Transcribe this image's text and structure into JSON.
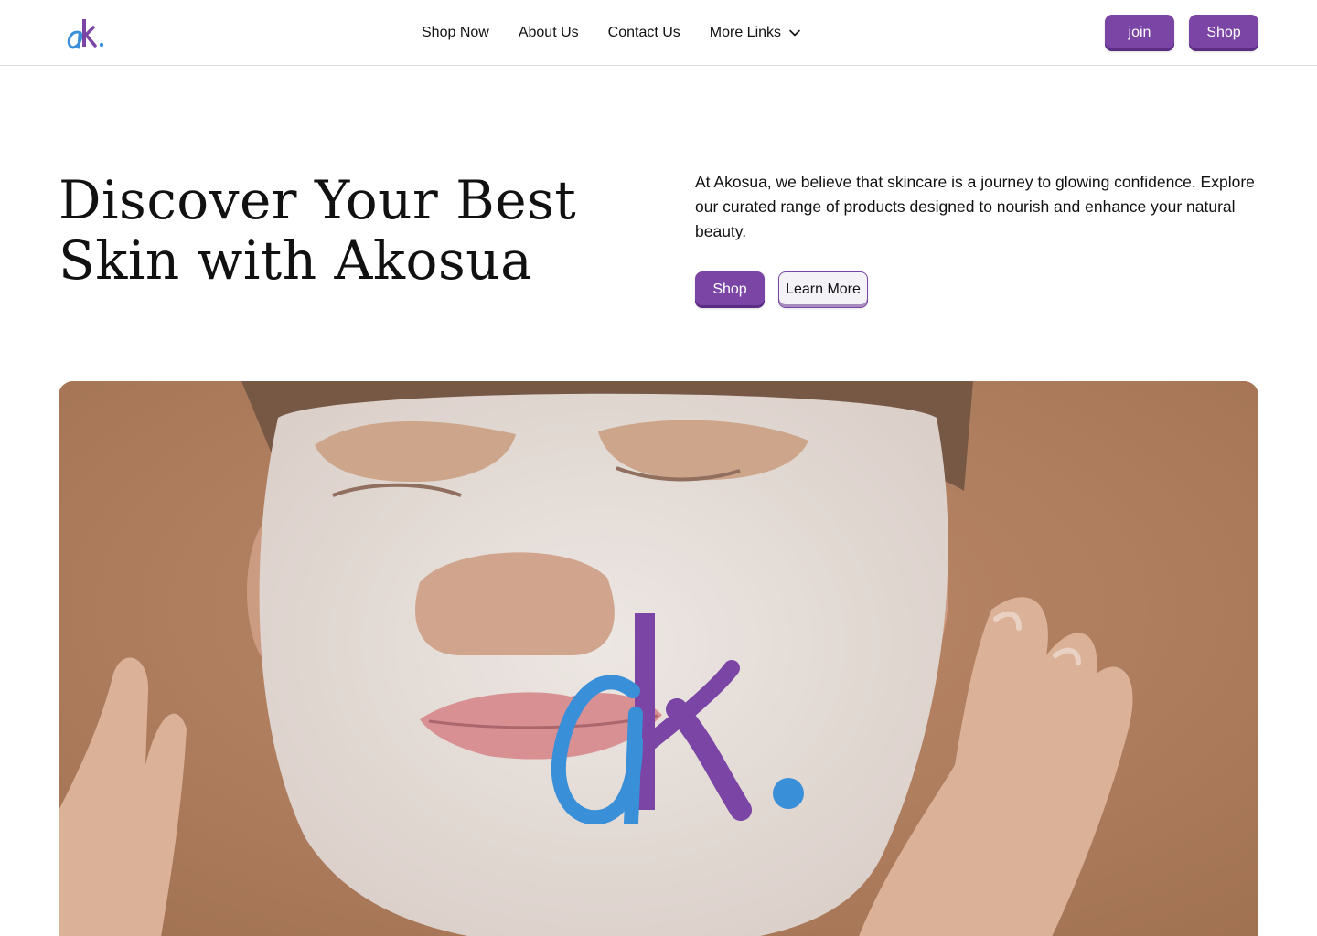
{
  "brand": {
    "logo_text": "ak.",
    "colors": {
      "blue": "#3a8fd9",
      "purple": "#7a45a4"
    }
  },
  "nav": {
    "links": [
      "Shop Now",
      "About Us",
      "Contact Us"
    ],
    "more_label": "More Links",
    "more_icon": "chevron-down-icon"
  },
  "header_buttons": {
    "join_label": "join",
    "shop_label": "Shop"
  },
  "hero": {
    "title_line1": "Discover Your Best",
    "title_line2": "Skin with Akosua",
    "description": "At Akosua, we believe that skincare is a journey to glowing confidence. Explore our curated range of products designed to nourish and enhance your natural beauty.",
    "shop_label": "Shop",
    "learn_more_label": "Learn More"
  },
  "theme": {
    "primary": "#7a45a4",
    "background": "#ffffff",
    "text": "#111111"
  }
}
